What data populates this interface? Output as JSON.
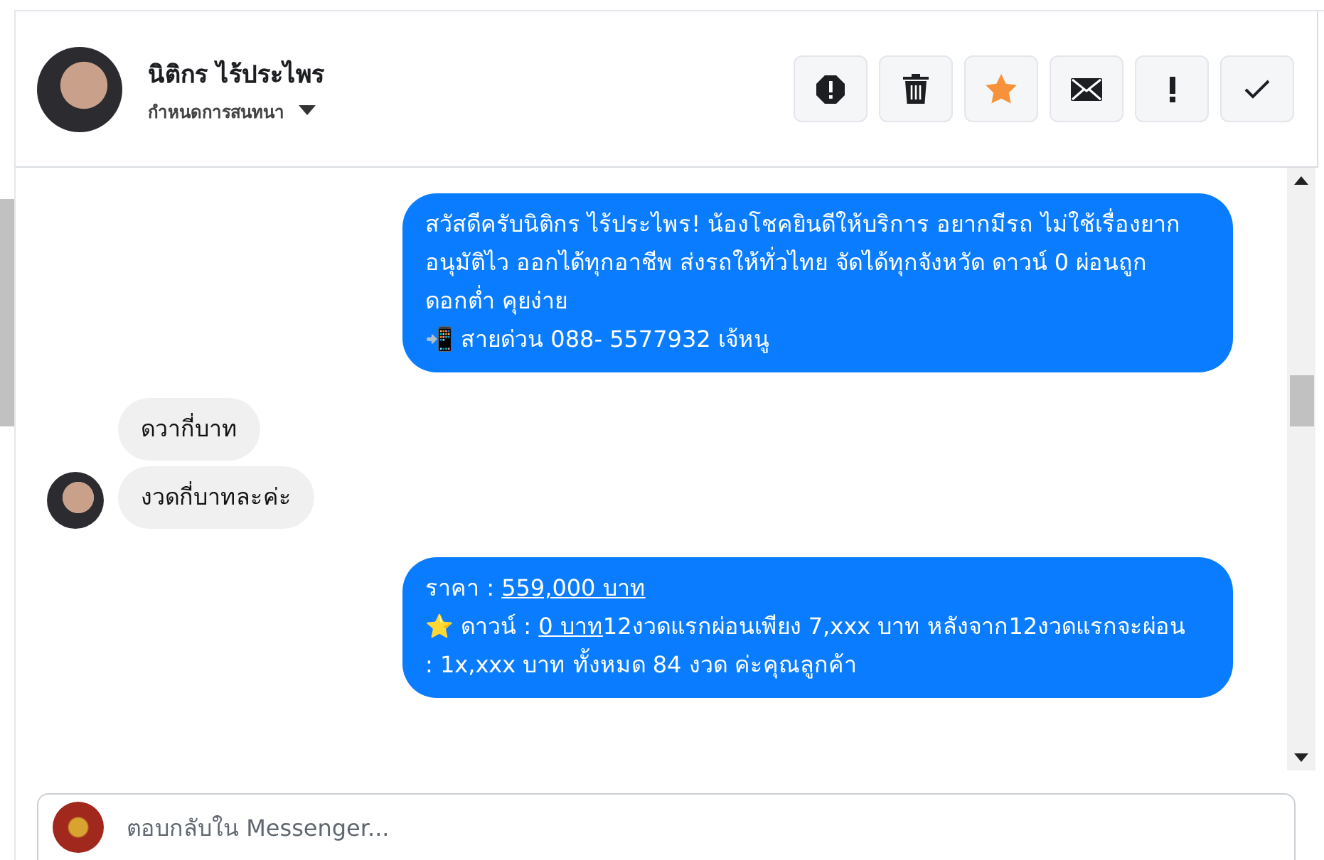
{
  "header": {
    "name": "นิติกร ไร้ประไพร",
    "subtitle": "กำหนดการสนทนา",
    "actions": [
      {
        "kind": "block"
      },
      {
        "kind": "trash"
      },
      {
        "kind": "star"
      },
      {
        "kind": "mail"
      },
      {
        "kind": "important"
      },
      {
        "kind": "done"
      }
    ]
  },
  "messages": [
    {
      "kind": "outgoing",
      "lines": [
        [
          {
            "text": "สวัสดีครับนิติกร ไร้ประไพร! น้องโชคยินดีให้บริการ อยากมีรถ ไม่ใช้เรื่องยาก",
            "link": false
          }
        ],
        [
          {
            "text": "อนุมัติไว ออกได้ทุกอาชีพ ส่งรถให้ทั่วไทย จัดได้ทุกจังหวัด ดาวน์ 0 ผ่อนถูก ดอกต่ำ คุยง่าย",
            "link": false
          }
        ],
        [
          {
            "text": "📲 สายด่วน 088- 5577932 เจ้หนู",
            "link": false
          }
        ]
      ]
    },
    {
      "kind": "incoming",
      "avatar": false,
      "lines": [
        [
          {
            "text": "ดวากี่บาท",
            "link": false
          }
        ]
      ]
    },
    {
      "kind": "incoming",
      "avatar": true,
      "lines": [
        [
          {
            "text": "งวดกี่บาทละค่ะ",
            "link": false
          }
        ]
      ]
    },
    {
      "kind": "outgoing",
      "lines": [
        [
          {
            "text": "ราคา : ",
            "link": false
          },
          {
            "text": "559,000 บาท",
            "link": true
          }
        ],
        [
          {
            "text": "⭐ ดาวน์ : ",
            "link": false
          },
          {
            "text": "0 บาท",
            "link": true
          },
          {
            "text": "12งวดแรกผ่อนเพียง 7,xxx บาท หลังจาก12งวดแรกจะผ่อน : 1x,xxx บาท ทั้งหมด 84 งวด ค่ะคุณลูกค้า",
            "link": false
          }
        ]
      ]
    }
  ],
  "composer": {
    "placeholder": "ตอบกลับใน Messenger..."
  }
}
